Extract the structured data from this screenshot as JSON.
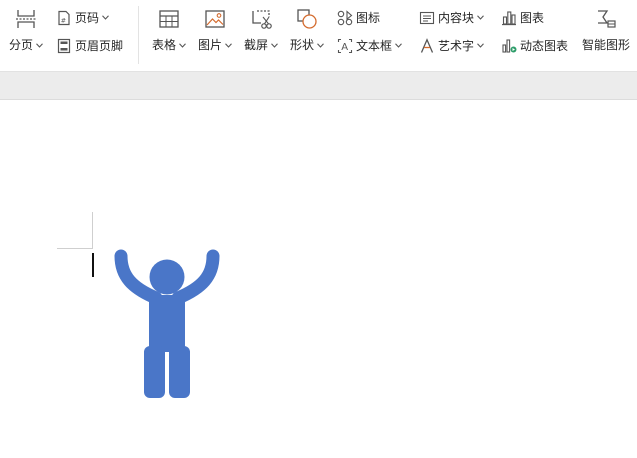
{
  "toolbar": {
    "page_break": "分页",
    "page_number": "页码",
    "header_footer": "页眉页脚",
    "table": "表格",
    "picture": "图片",
    "screenshot": "截屏",
    "shape": "形状",
    "icon": "图标",
    "text_box": "文本框",
    "content_block": "内容块",
    "word_art": "艺术字",
    "chart": "图表",
    "dynamic_chart": "动态图表",
    "smart_art": "智能图形"
  },
  "colors": {
    "icon_gray": "#555555",
    "icon_accent": "#d46b2e",
    "icon_green": "#2e9d6a",
    "figure_blue": "#4a76c8"
  },
  "icons": {
    "page_break": "page-break-icon",
    "page_number": "page-number-icon",
    "header_footer": "header-footer-icon",
    "table": "table-icon",
    "picture": "picture-icon",
    "screenshot": "scissors-icon",
    "shape": "shape-icon",
    "icon": "icon-library-icon",
    "text_box": "text-box-icon",
    "content_block": "content-block-icon",
    "word_art": "word-art-icon",
    "chart": "bar-chart-icon",
    "dynamic_chart": "dynamic-chart-icon",
    "smart_art": "smart-art-icon",
    "figure": "person-arms-raised-icon"
  }
}
